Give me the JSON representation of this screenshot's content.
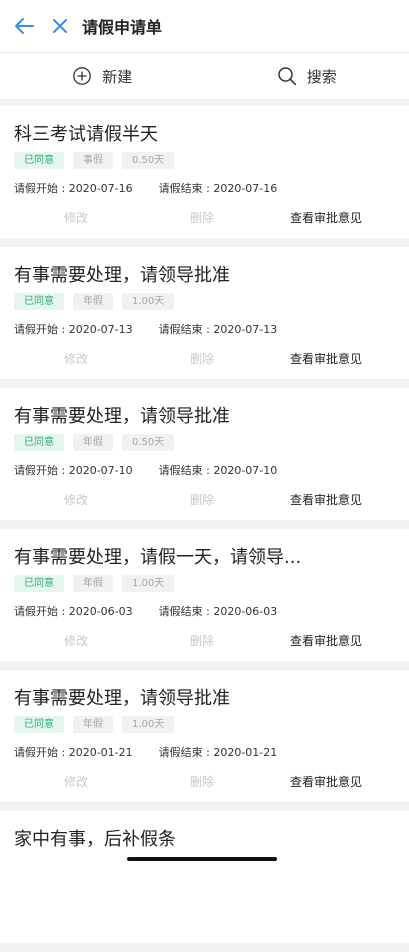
{
  "header": {
    "title": "请假申请单"
  },
  "toolbar": {
    "new_label": "新建",
    "search_label": "搜索"
  },
  "colors": {
    "accent": "#3a8ee6",
    "status_green": "#2fae74"
  },
  "labels": {
    "start_prefix": "请假开始 : ",
    "end_prefix": "请假结束 : ",
    "edit": "修改",
    "delete": "删除",
    "view": "查看审批意见"
  },
  "requests": [
    {
      "title": "科三考试请假半天",
      "status": "已同意",
      "type": "事假",
      "days": "0.50天",
      "start": "2020-07-16",
      "end": "2020-07-16"
    },
    {
      "title": "有事需要处理，请领导批准",
      "status": "已同意",
      "type": "年假",
      "days": "1.00天",
      "start": "2020-07-13",
      "end": "2020-07-13"
    },
    {
      "title": "有事需要处理，请领导批准",
      "status": "已同意",
      "type": "年假",
      "days": "0.50天",
      "start": "2020-07-10",
      "end": "2020-07-10"
    },
    {
      "title": "有事需要处理，请假一天，请领导...",
      "status": "已同意",
      "type": "年假",
      "days": "1.00天",
      "start": "2020-06-03",
      "end": "2020-06-03"
    },
    {
      "title": "有事需要处理，请领导批准",
      "status": "已同意",
      "type": "年假",
      "days": "1.00天",
      "start": "2020-01-21",
      "end": "2020-01-21"
    },
    {
      "title": "家中有事，后补假条"
    }
  ]
}
